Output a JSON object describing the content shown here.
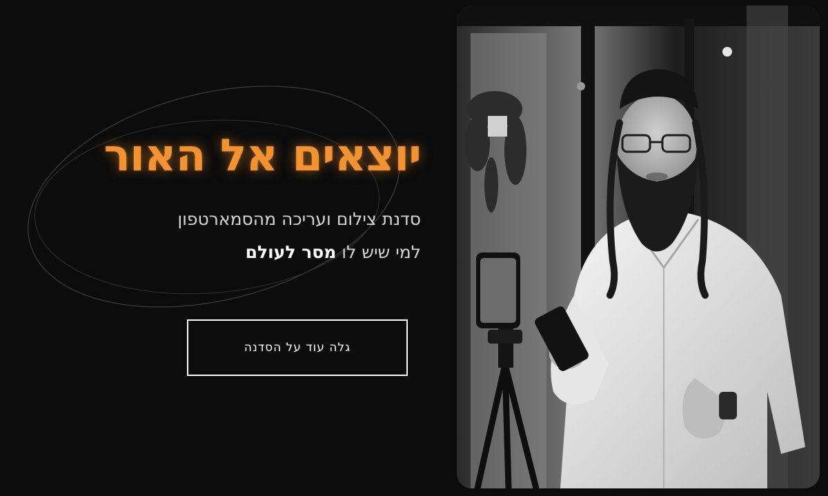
{
  "hero": {
    "title": "יוצאים אל האור",
    "subtitle_line1": "סדנת צילום ועריכה מהסמארטפון",
    "subtitle_line2_prefix": "למי שיש לו ",
    "subtitle_line2_bold": "מסר לעולם"
  },
  "cta": {
    "label": "גלה עוד על הסדנה"
  },
  "photo": {
    "icon": "workshop-instructor-photo"
  },
  "colors": {
    "background": "#0c0c0c",
    "accent_orange": "#f39231",
    "text_light": "#d6d6d6",
    "button_border": "#ffffff"
  }
}
